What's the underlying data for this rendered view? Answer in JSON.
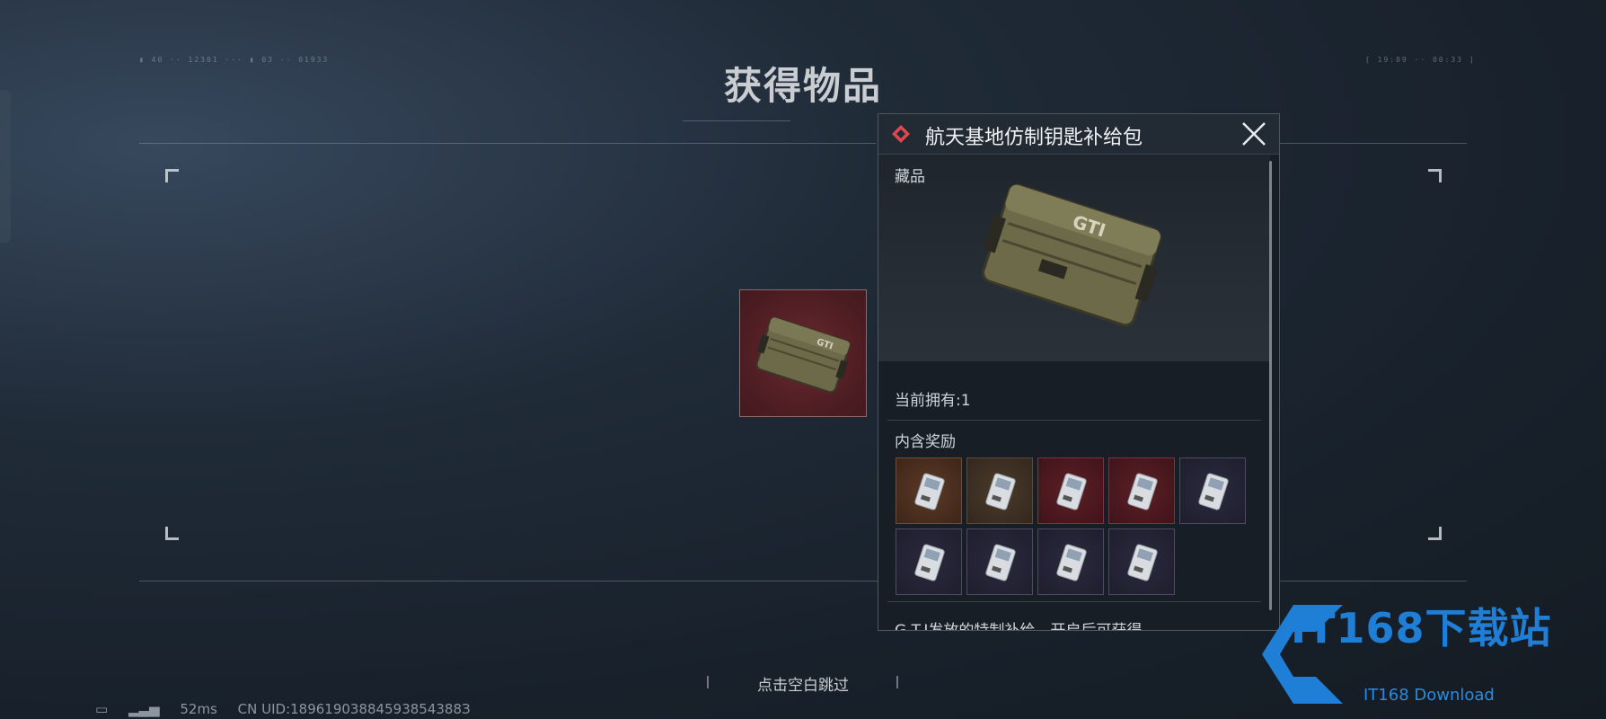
{
  "page_title": "获得物品",
  "item_popup": {
    "title": "航天基地仿制钥匙补给包",
    "category": "藏品",
    "owned_label": "当前拥有:1",
    "rewards_label": "内含奖励",
    "description_partial": "G.T.I发放的特制补给，开启后可获得",
    "rewards": [
      {
        "rarity": "gold",
        "icon": "keycard-icon"
      },
      {
        "rarity": "amber",
        "icon": "keycard-icon"
      },
      {
        "rarity": "red",
        "icon": "keycard-icon"
      },
      {
        "rarity": "red",
        "icon": "keycard-icon"
      },
      {
        "rarity": "violet",
        "icon": "keycard-icon"
      },
      {
        "rarity": "violet",
        "icon": "keycard-icon"
      },
      {
        "rarity": "violet",
        "icon": "keycard-icon"
      },
      {
        "rarity": "violet",
        "icon": "keycard-icon"
      },
      {
        "rarity": "violet",
        "icon": "keycard-icon"
      }
    ],
    "case_logo": "GTI"
  },
  "skip_hint": "点击空白跳过",
  "status_bar": {
    "ping": "52ms",
    "uid": "CN UID:18961903884593854388З"
  },
  "watermark": {
    "brand": "IT168下载站",
    "sub": "IT168 Download"
  },
  "colors": {
    "accent_red": "#e0464f",
    "watermark_blue": "#1f7fd6"
  }
}
